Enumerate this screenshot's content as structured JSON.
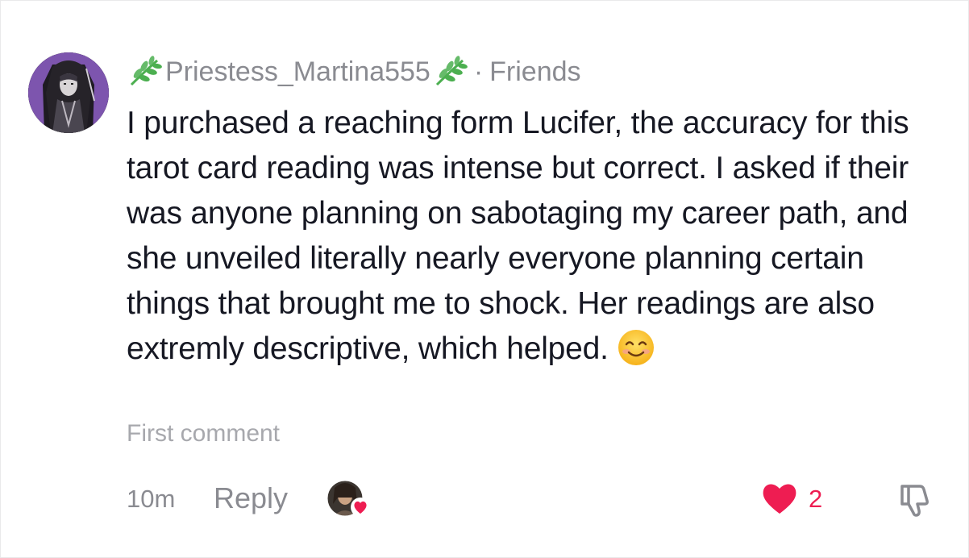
{
  "comment": {
    "username": "Priestess_Martina555",
    "separator": "·",
    "relation": "Friends",
    "text": "I purchased a reaching form Lucifer, the accuracy for this tarot card reading was intense but correct. I asked if their was anyone planning on sabotaging my career path, and she unveiled literally nearly everyone planning certain things that brought me to shock. Her readings are also extremly descriptive, which helped.",
    "emoji_icon": "smiling-face-icon",
    "label": "First comment"
  },
  "footer": {
    "timestamp": "10m",
    "reply_label": "Reply",
    "like_count": "2"
  },
  "icons": {
    "leading_decoration": "herb-icon",
    "trailing_decoration": "herb-icon",
    "like": "heart-icon",
    "dislike": "thumbs-down-icon"
  },
  "colors": {
    "like_red": "#ee1d52",
    "muted_gray": "#8a8b91",
    "text": "#161823",
    "herb_green": "#4caf50"
  }
}
